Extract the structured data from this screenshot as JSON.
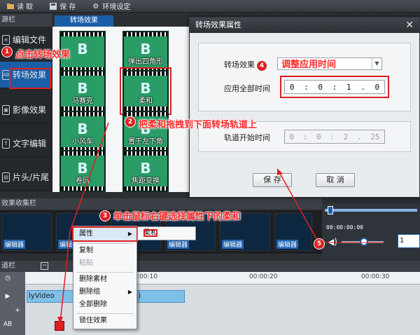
{
  "toolbar": {
    "read": "读 取",
    "save": "保 存",
    "env": "环境设定"
  },
  "sidebar": {
    "title": "源栏",
    "items": [
      {
        "label": "编辑文件"
      },
      {
        "label": "转场效果"
      },
      {
        "label": "影像效果"
      },
      {
        "label": "文字编辑"
      },
      {
        "label": "片头/片尾"
      }
    ]
  },
  "transitions": {
    "tab": "转场效果",
    "thumbs": [
      {
        "label": ""
      },
      {
        "label": "弹出四角形"
      },
      {
        "label": "马赛克"
      },
      {
        "label": "柔和"
      },
      {
        "label": "小风车"
      },
      {
        "label": "置于左下角"
      },
      {
        "label": "卷回"
      },
      {
        "label": "焦距变换"
      }
    ]
  },
  "material": {
    "title": "效果收集栏",
    "clip_tag": "编辑器"
  },
  "timeline": {
    "title": "道栏",
    "ticks": [
      ":00:10",
      "00:00:20",
      "00:00:30"
    ],
    "clip_label": "lyVideo",
    "clip_suffix": "1)"
  },
  "context_menu": {
    "items": [
      {
        "label": "属性",
        "has_submenu": true
      },
      {
        "label": "复制"
      },
      {
        "label": "粘贴",
        "disabled": true
      },
      {
        "label": "删除素材"
      },
      {
        "label": "删除组",
        "has_submenu": true
      },
      {
        "label": "全部删除"
      },
      {
        "label": "锁住效果"
      }
    ],
    "submenu": "柔和"
  },
  "dialog": {
    "title": "转场效果属性",
    "effect_label": "转场效果",
    "apply_all_label": "应用全部时间",
    "time_all": [
      "0",
      ":",
      "0",
      ":",
      "1",
      ".",
      "0"
    ],
    "track_start_label": "轨道开始时间",
    "time_start": [
      "0",
      ":",
      "0",
      ":",
      "2",
      ".",
      "25"
    ],
    "save": "保 存",
    "cancel": "取 消"
  },
  "preview": {
    "time": "00:00:00:00",
    "volume": "1"
  },
  "annotations": [
    {
      "num": "1",
      "text": "点击转场效果"
    },
    {
      "num": "2",
      "text": "把柔和拖拽到下面转场轨道上"
    },
    {
      "num": "3",
      "text": "单击鼠标右键选择属性下的柔和"
    },
    {
      "num": "4",
      "text": "调整应用时间"
    },
    {
      "num": "5",
      "text": ""
    }
  ],
  "colors": {
    "accent": "#1b5ea8",
    "annotation": "#e02020",
    "clip": "#7fc0e8"
  }
}
